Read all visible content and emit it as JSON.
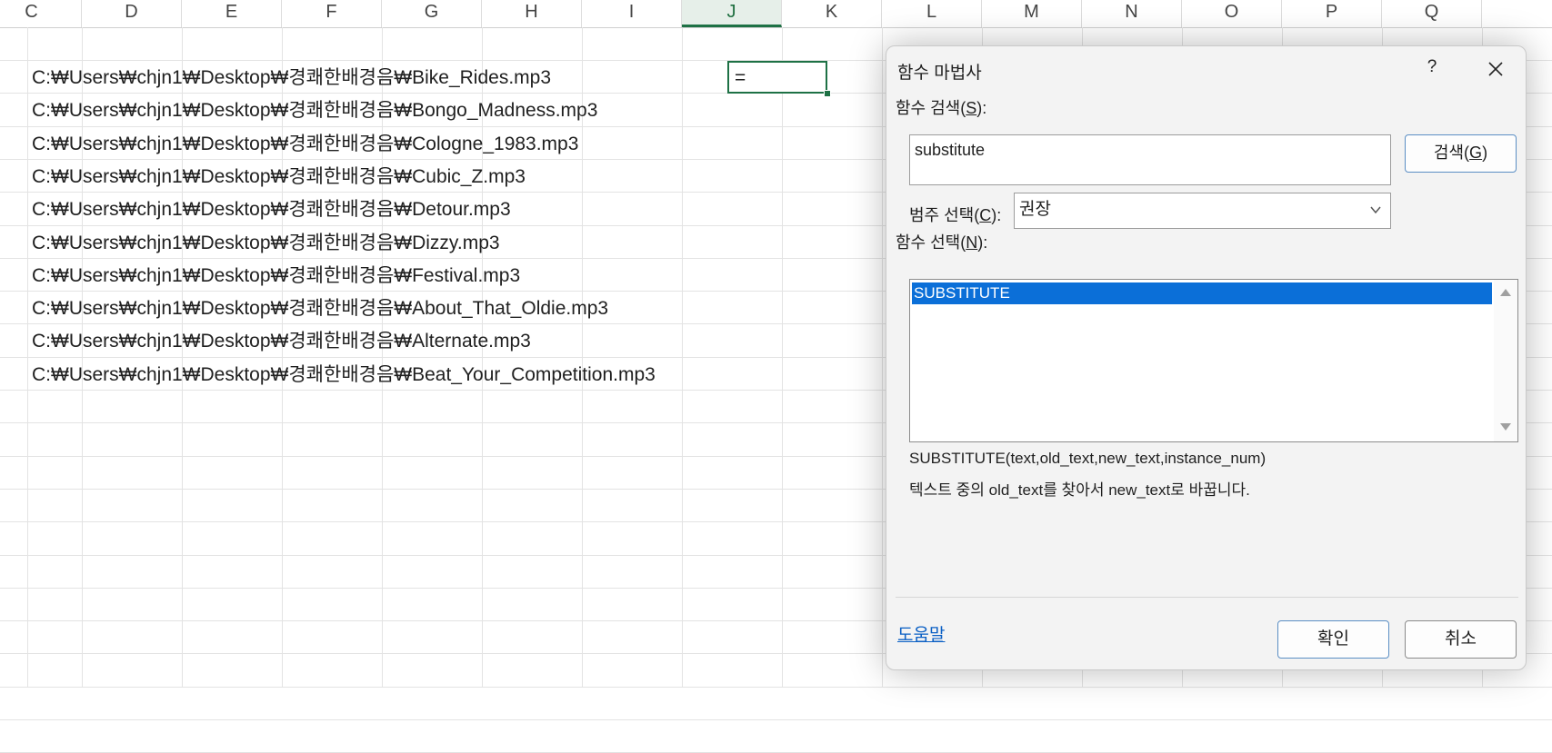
{
  "sheet": {
    "columns": [
      "C",
      "D",
      "E",
      "F",
      "G",
      "H",
      "I",
      "J",
      "K",
      "L",
      "M",
      "N",
      "O",
      "P",
      "Q"
    ],
    "selected_column": "J",
    "rows": [
      "C:₩Users₩chjn1₩Desktop₩경쾌한배경음₩Bike_Rides.mp3",
      "C:₩Users₩chjn1₩Desktop₩경쾌한배경음₩Bongo_Madness.mp3",
      "C:₩Users₩chjn1₩Desktop₩경쾌한배경음₩Cologne_1983.mp3",
      "C:₩Users₩chjn1₩Desktop₩경쾌한배경음₩Cubic_Z.mp3",
      "C:₩Users₩chjn1₩Desktop₩경쾌한배경음₩Detour.mp3",
      "C:₩Users₩chjn1₩Desktop₩경쾌한배경음₩Dizzy.mp3",
      "C:₩Users₩chjn1₩Desktop₩경쾌한배경음₩Festival.mp3",
      "C:₩Users₩chjn1₩Desktop₩경쾌한배경음₩About_That_Oldie.mp3",
      "C:₩Users₩chjn1₩Desktop₩경쾌한배경음₩Alternate.mp3",
      "C:₩Users₩chjn1₩Desktop₩경쾌한배경음₩Beat_Your_Competition.mp3"
    ],
    "active_cell_value": "="
  },
  "dialog": {
    "title": "함수 마법사",
    "help_button": "?",
    "search_label_prefix": "함수 검색(",
    "search_label_key": "S",
    "search_label_suffix": "):",
    "search_value": "substitute",
    "search_button_prefix": "검색(",
    "search_button_key": "G",
    "search_button_suffix": ")",
    "category_label_prefix": "범주 선택(",
    "category_label_key": "C",
    "category_label_suffix": "):",
    "category_value": "권장",
    "function_label_prefix": "함수 선택(",
    "function_label_key": "N",
    "function_label_suffix": "):",
    "functions": [
      "SUBSTITUTE"
    ],
    "signature": "SUBSTITUTE(text,old_text,new_text,instance_num)",
    "description": "텍스트 중의 old_text를 찾아서 new_text로 바꿉니다.",
    "help_link": "도움말",
    "ok_button": "확인",
    "cancel_button": "취소"
  },
  "colors": {
    "selection_green": "#1e7145",
    "list_highlight": "#0b6fd8",
    "link_blue": "#0a5fc4"
  }
}
